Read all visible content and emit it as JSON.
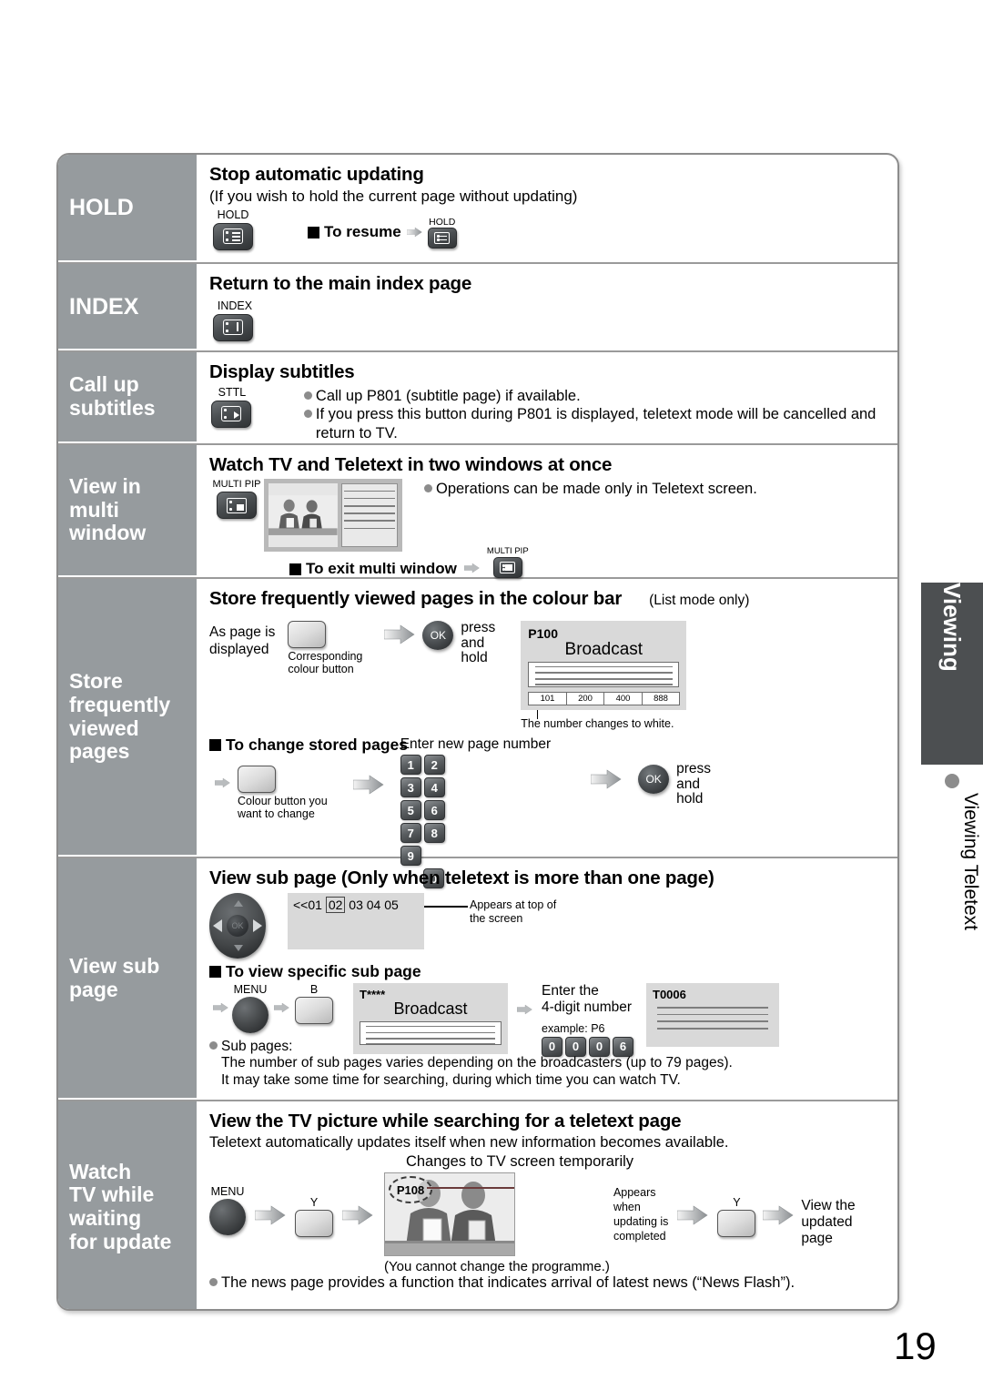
{
  "page_number": "19",
  "side_tab": {
    "label": "Viewing",
    "caption": "Viewing Teletext"
  },
  "sections": [
    {
      "side_label": "HOLD",
      "heading": "Stop automatic updating",
      "subheading": "(If you wish to hold the current page without updating)",
      "button_label": "HOLD",
      "resume_label": "To resume",
      "resume_button_label": "HOLD"
    },
    {
      "side_label": "INDEX",
      "heading": "Return to the main index page",
      "button_label": "INDEX"
    },
    {
      "side_label_lines": [
        "Call up",
        "subtitles"
      ],
      "heading": "Display subtitles",
      "button_label": "STTL",
      "bullets": [
        "Call up P801 (subtitle page) if available.",
        "If you press this button during P801 is displayed, teletext mode will be cancelled and return to TV."
      ]
    },
    {
      "side_label_lines": [
        "View in",
        "multi",
        "window"
      ],
      "heading": "Watch TV and Teletext in two windows at once",
      "button_label": "MULTI PIP",
      "bullets": [
        "Operations can be made only in Teletext screen."
      ],
      "exit_label": "To exit multi window",
      "exit_button_label": "MULTI PIP"
    },
    {
      "side_label_lines": [
        "Store",
        "frequently",
        "viewed",
        "pages"
      ],
      "heading": "Store frequently viewed pages in the colour bar",
      "heading_note": "(List mode only)",
      "step1_text_lines": [
        "As page is",
        "displayed"
      ],
      "colour_button_caption_lines": [
        "Corresponding",
        "colour button"
      ],
      "ok_label": "OK",
      "press_hold_lines": [
        "press",
        "and",
        "hold"
      ],
      "screen": {
        "page_tag": "P100",
        "title": "Broadcast",
        "colour_bar": [
          "101",
          "200",
          "400",
          "888"
        ]
      },
      "screen_note": "The number changes to white.",
      "change_heading": "To change stored pages",
      "change_button_caption_lines": [
        "Colour button you",
        "want to change"
      ],
      "enter_label": "Enter new page number",
      "keypad": [
        "1",
        "2",
        "3",
        "4",
        "5",
        "6",
        "7",
        "8",
        "9",
        "0"
      ]
    },
    {
      "side_label_lines": [
        "View sub",
        "page"
      ],
      "heading": "View sub page (Only when teletext is more than one page)",
      "subpage_indicator": "<<01 02 03 04 05",
      "subpage_highlight": "02",
      "indicator_note_lines": [
        "Appears at top of",
        "the screen"
      ],
      "specific_heading": "To view specific sub page",
      "menu_label": "MENU",
      "colour_btn_label": "B",
      "screen_a": {
        "page_tag": "T****",
        "title": "Broadcast"
      },
      "enter_lines": [
        "Enter the",
        "4-digit number"
      ],
      "example_label": "example: P6",
      "example_keys": [
        "0",
        "0",
        "0",
        "6"
      ],
      "screen_b": {
        "page_tag": "T0006"
      },
      "note_label": "Sub pages:",
      "note_lines": [
        "The number of sub pages varies depending on the broadcasters (up to 79 pages).",
        "It may take some time for searching, during which time you can watch TV."
      ]
    },
    {
      "side_label_lines": [
        "Watch",
        "TV while",
        "waiting",
        "for update"
      ],
      "heading": "View the TV picture while searching for a teletext page",
      "subheading": "Teletext automatically updates itself when new information becomes available.",
      "changes_label": "Changes to TV screen temporarily",
      "menu_label": "MENU",
      "colour_btn_label_1": "Y",
      "colour_btn_label_2": "Y",
      "tv_page_tag": "P108",
      "appears_lines": [
        "Appears",
        "when",
        "updating is",
        "completed"
      ],
      "view_updated_lines": [
        "View the",
        "updated",
        "page"
      ],
      "programme_note": "(You cannot change the programme.)",
      "news_note": "The news page provides a function that indicates arrival of latest news (“News Flash”)."
    }
  ],
  "colors": {
    "sidebar_bg": "#969b9e",
    "tab_bg": "#4c4f51",
    "screen_bg": "#d9d9d9",
    "rule": "#9a9a9a"
  }
}
